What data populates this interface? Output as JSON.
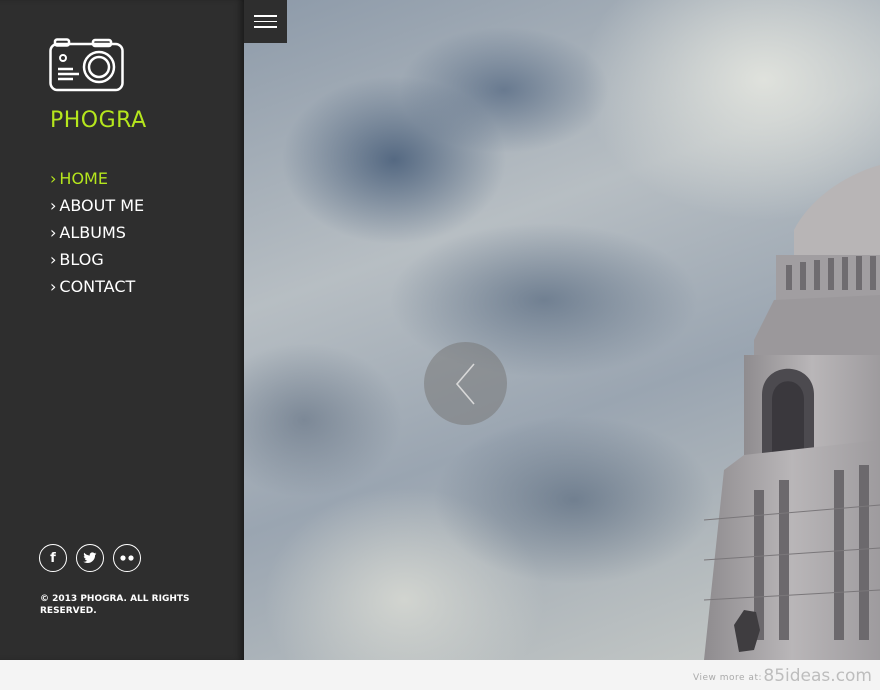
{
  "brand": {
    "name": "PHOGRA",
    "logo_icon": "camera-icon",
    "accent": "#b5e61d"
  },
  "nav": {
    "items": [
      {
        "label": "HOME",
        "active": true
      },
      {
        "label": "ABOUT ME",
        "active": false
      },
      {
        "label": "ALBUMS",
        "active": false
      },
      {
        "label": "BLOG",
        "active": false
      },
      {
        "label": "CONTACT",
        "active": false
      }
    ],
    "arrow": "›"
  },
  "social": {
    "items": [
      {
        "icon": "facebook-icon",
        "glyph": "f"
      },
      {
        "icon": "twitter-icon",
        "glyph": ""
      },
      {
        "icon": "flickr-icon",
        "glyph": ""
      }
    ]
  },
  "copyright": "© 2013 PHOGRA. ALL RIGHTS RESERVED.",
  "toolbar": {
    "menu_icon": "hamburger-icon"
  },
  "slider": {
    "prev_icon": "chevron-left-icon"
  },
  "footer": {
    "view_more": "View more at:",
    "site": "85ideas.com"
  },
  "colors": {
    "sidebar": "#2e2e2e",
    "text": "#ffffff",
    "accent": "#b5e61d"
  }
}
